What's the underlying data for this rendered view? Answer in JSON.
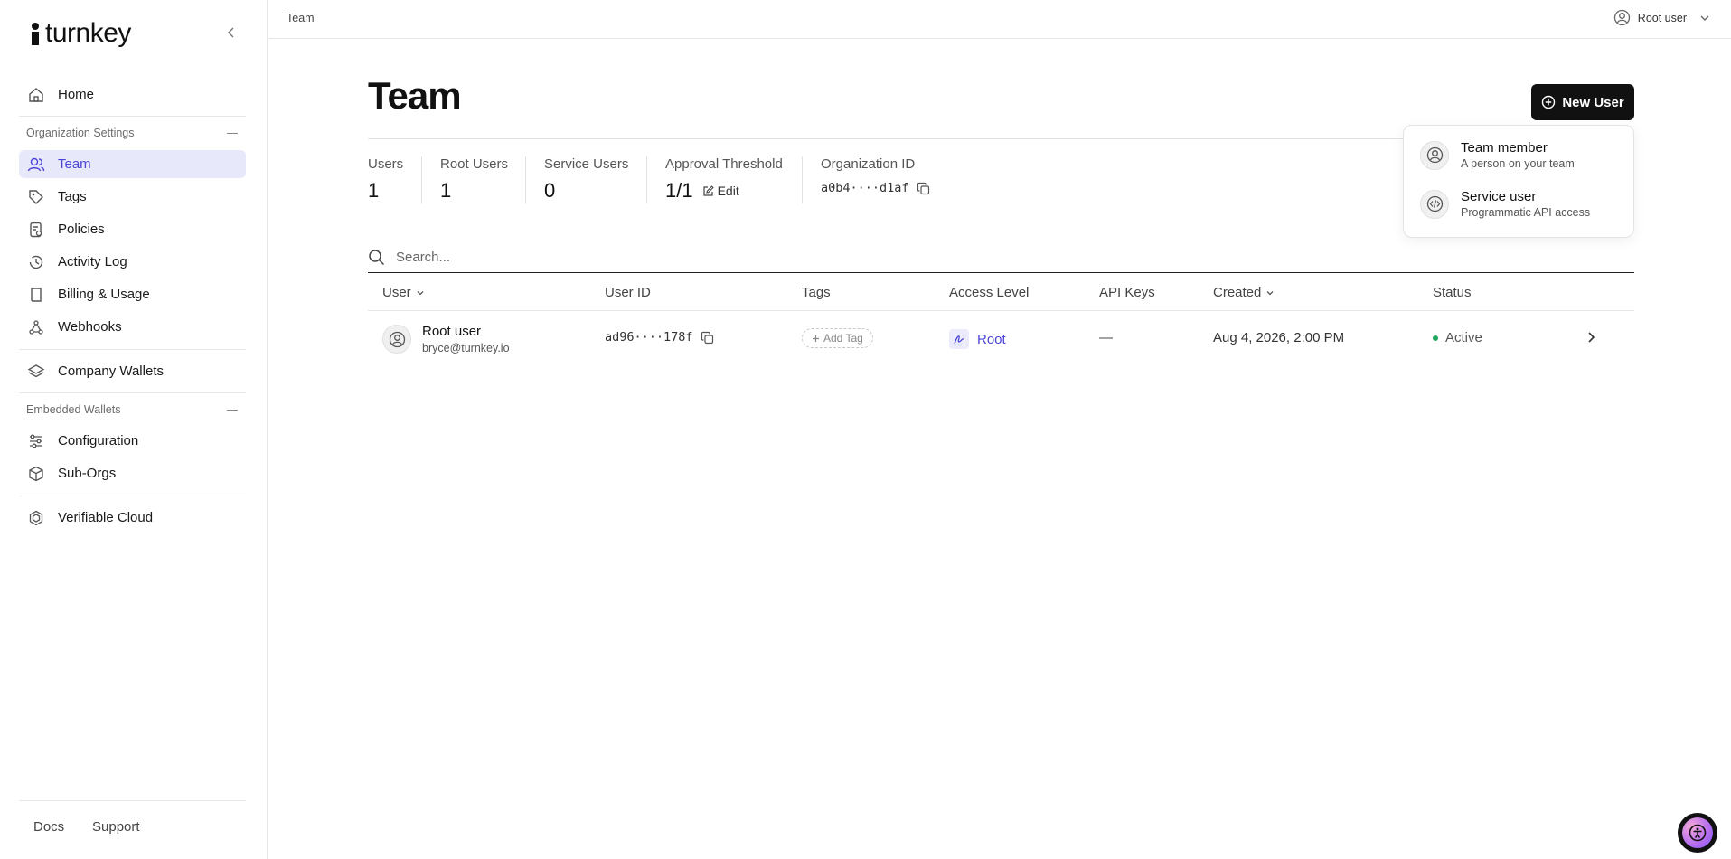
{
  "app": {
    "brand": "turnkey"
  },
  "sidebar": {
    "items": [
      {
        "label": "Home"
      },
      {
        "label": "Team"
      },
      {
        "label": "Tags"
      },
      {
        "label": "Policies"
      },
      {
        "label": "Activity Log"
      },
      {
        "label": "Billing & Usage"
      },
      {
        "label": "Webhooks"
      },
      {
        "label": "Company Wallets"
      },
      {
        "label": "Configuration"
      },
      {
        "label": "Sub-Orgs"
      },
      {
        "label": "Verifiable Cloud"
      }
    ],
    "sections": {
      "org_settings": "Organization Settings",
      "embedded_wallets": "Embedded Wallets"
    },
    "footer": {
      "docs": "Docs",
      "support": "Support"
    }
  },
  "topbar": {
    "breadcrumb": "Team",
    "user_label": "Root user"
  },
  "page": {
    "title": "Team",
    "new_user_label": "New User"
  },
  "stats": {
    "users": {
      "label": "Users",
      "value": "1"
    },
    "root_users": {
      "label": "Root Users",
      "value": "1"
    },
    "service_users": {
      "label": "Service Users",
      "value": "0"
    },
    "approval": {
      "label": "Approval Threshold",
      "value": "1/1",
      "edit": "Edit"
    },
    "org_id": {
      "label": "Organization ID",
      "value": "a0b4····d1af"
    }
  },
  "search": {
    "placeholder": "Search..."
  },
  "table": {
    "columns": {
      "user": "User",
      "user_id": "User ID",
      "tags": "Tags",
      "access_level": "Access Level",
      "api_keys": "API Keys",
      "created": "Created",
      "status": "Status"
    },
    "rows": [
      {
        "name": "Root user",
        "email": "bryce@turnkey.io",
        "user_id": "ad96····178f",
        "add_tag": "Add Tag",
        "access_level": "Root",
        "api_keys": "—",
        "created": "Aug 4, 2026, 2:00 PM",
        "status": "Active"
      }
    ]
  },
  "dropdown": {
    "items": [
      {
        "title": "Team member",
        "desc": "A person on your team"
      },
      {
        "title": "Service user",
        "desc": "Programmatic API access"
      }
    ]
  },
  "colors": {
    "accent": "#4b46d6",
    "active_bg": "#e8e8fb",
    "status_active": "#22a55a",
    "button_bg": "#111111"
  }
}
